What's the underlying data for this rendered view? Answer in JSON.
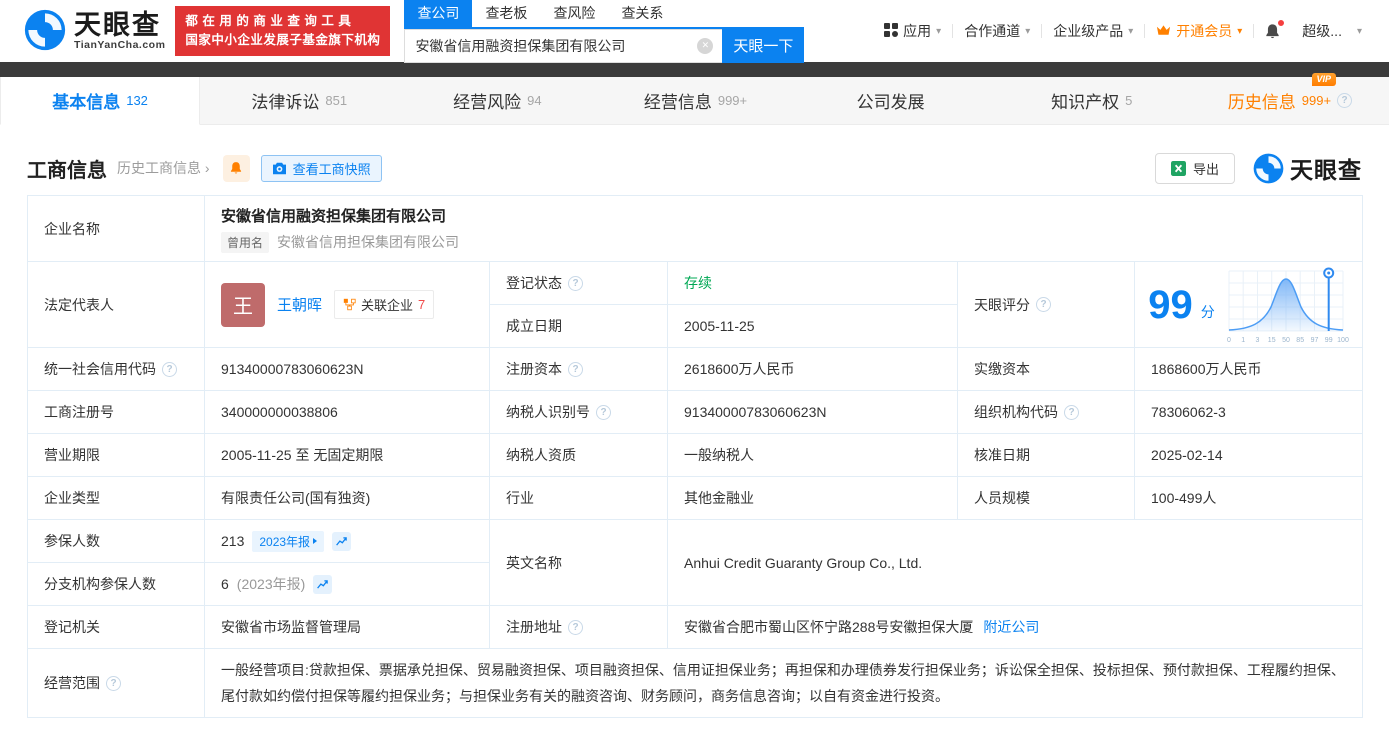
{
  "icons": {
    "caret": "▾",
    "arrow": "›",
    "help": "?",
    "clear": "✕",
    "vip": "VIP"
  },
  "header": {
    "logo_title": "天眼查",
    "logo_domain": "TianYanCha.com",
    "promo_line1": "都在用的商业查询工具",
    "promo_line2": "国家中小企业发展子基金旗下机构",
    "search_tabs": [
      {
        "label": "查公司"
      },
      {
        "label": "查老板"
      },
      {
        "label": "查风险"
      },
      {
        "label": "查关系"
      }
    ],
    "search_value": "安徽省信用融资担保集团有限公司",
    "search_button": "天眼一下",
    "nav_apps": "应用",
    "nav_partner": "合作通道",
    "nav_enterprise": "企业级产品",
    "nav_vip": "开通会员",
    "nav_super": "超级..."
  },
  "tabs": [
    {
      "label": "基本信息",
      "count": "132"
    },
    {
      "label": "法律诉讼",
      "count": "851"
    },
    {
      "label": "经营风险",
      "count": "94"
    },
    {
      "label": "经营信息",
      "count": "999+"
    },
    {
      "label": "公司发展",
      "count": ""
    },
    {
      "label": "知识产权",
      "count": "5"
    },
    {
      "label": "历史信息",
      "count": "999+"
    }
  ],
  "section": {
    "title": "工商信息",
    "history_link": "历史工商信息",
    "snapshot_button": "查看工商快照",
    "export_button": "导出",
    "watermark_title": "天眼查"
  },
  "table": {
    "company_name_label": "企业名称",
    "company_name": "安徽省信用融资担保集团有限公司",
    "former_name_tag": "曾用名",
    "former_name": "安徽省信用担保集团有限公司",
    "legal_rep_label": "法定代表人",
    "legal_rep_avatar": "王",
    "legal_rep_name": "王朝晖",
    "related_company_label": "关联企业",
    "related_company_count": "7",
    "reg_status_label": "登记状态",
    "reg_status": "存续",
    "established_label": "成立日期",
    "established": "2005-11-25",
    "score_label": "天眼评分",
    "score": "99",
    "score_unit": "分",
    "score_axis": [
      "0",
      "1",
      "3",
      "15",
      "50",
      "85",
      "97",
      "99",
      "100"
    ],
    "credit_code_label": "统一社会信用代码",
    "credit_code": "91340000783060623N",
    "reg_capital_label": "注册资本",
    "reg_capital": "2618600万人民币",
    "paid_capital_label": "实缴资本",
    "paid_capital": "1868600万人民币",
    "reg_number_label": "工商注册号",
    "reg_number": "340000000038806",
    "taxpayer_id_label": "纳税人识别号",
    "taxpayer_id": "91340000783060623N",
    "org_code_label": "组织机构代码",
    "org_code": "78306062-3",
    "business_term_label": "营业期限",
    "business_term": "2005-11-25 至 无固定期限",
    "taxpayer_quality_label": "纳税人资质",
    "taxpayer_quality": "一般纳税人",
    "approval_date_label": "核准日期",
    "approval_date": "2025-02-14",
    "company_type_label": "企业类型",
    "company_type": "有限责任公司(国有独资)",
    "industry_label": "行业",
    "industry": "其他金融业",
    "staff_size_label": "人员规模",
    "staff_size": "100-499人",
    "insured_label": "参保人数",
    "insured_count": "213",
    "insured_report_tag": "2023年报",
    "branch_insured_label": "分支机构参保人数",
    "branch_insured_count": "6",
    "branch_insured_report": "(2023年报)",
    "english_name_label": "英文名称",
    "english_name": "Anhui Credit Guaranty Group Co., Ltd.",
    "reg_authority_label": "登记机关",
    "reg_authority": "安徽省市场监督管理局",
    "reg_address_label": "注册地址",
    "reg_address": "安徽省合肥市蜀山区怀宁路288号安徽担保大厦",
    "nearby_link": "附近公司",
    "business_scope_label": "经营范围",
    "business_scope": "一般经营项目:贷款担保、票据承兑担保、贸易融资担保、项目融资担保、信用证担保业务；再担保和办理债券发行担保业务；诉讼保全担保、投标担保、预付款担保、工程履约担保、尾付款如约偿付担保等履约担保业务；与担保业务有关的融资咨询、财务顾问，商务信息咨询；以自有资金进行投资。"
  }
}
